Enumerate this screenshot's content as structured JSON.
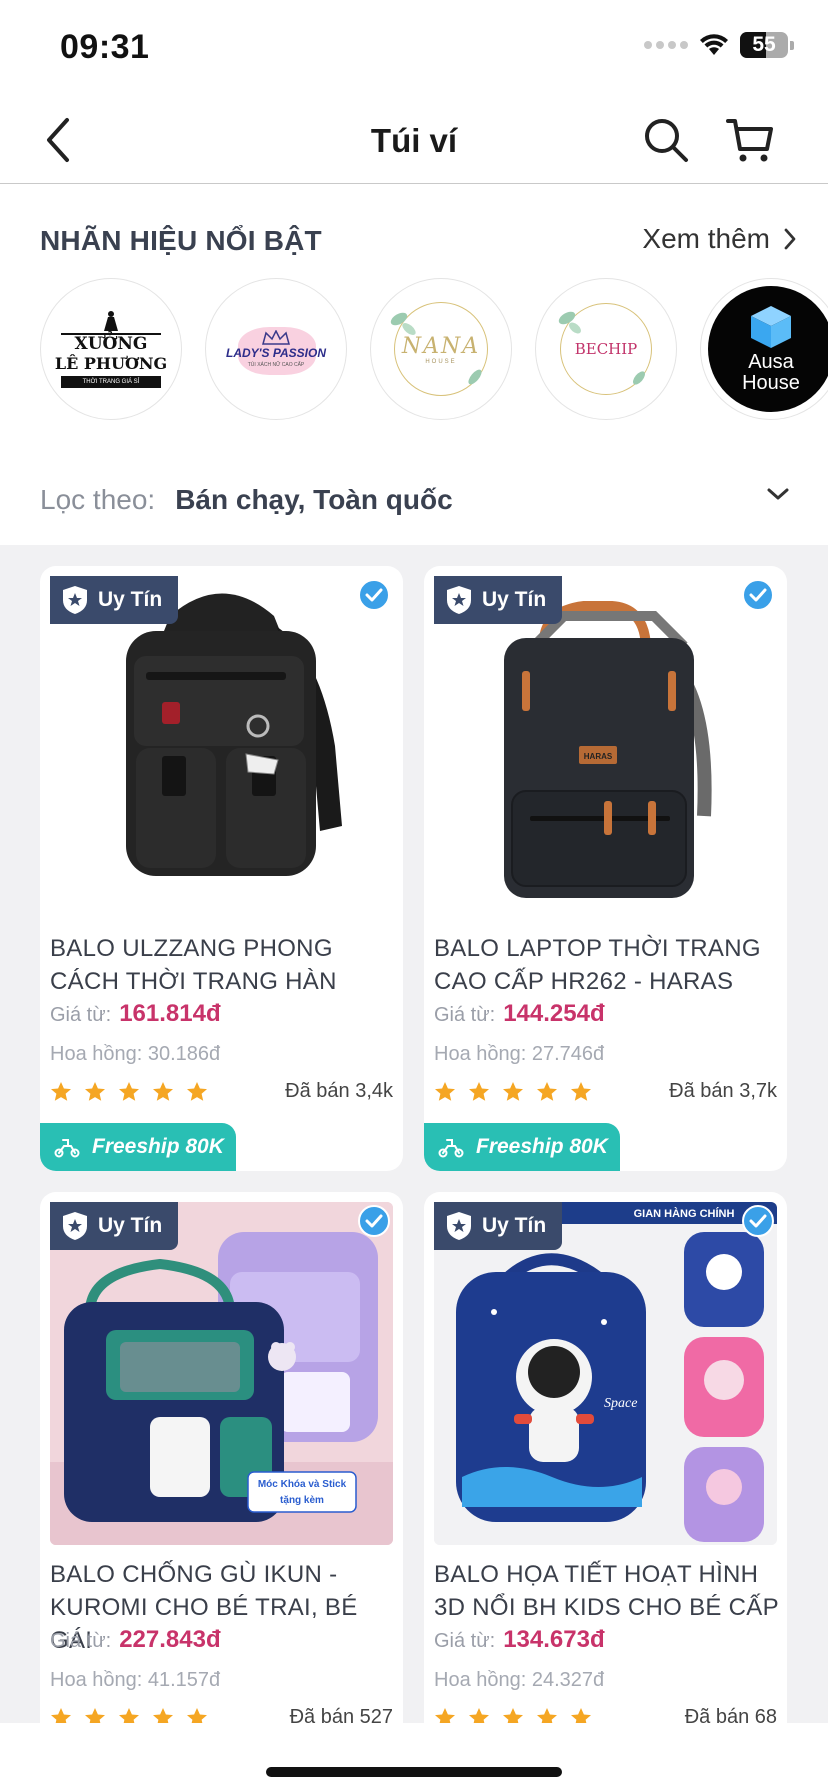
{
  "status_bar": {
    "time": "09:31",
    "battery": "55",
    "battery_level_percent": 55
  },
  "header": {
    "title": "Túi ví",
    "back_icon": "chevron-left-icon",
    "search_icon": "search-icon",
    "cart_icon": "cart-icon"
  },
  "brands": {
    "title": "NHÃN HIỆU NỔI BẬT",
    "see_more": "Xem thêm",
    "items": [
      {
        "name": "XƯỞNG LÊ PHƯƠNG",
        "line1": "XƯỞNG",
        "line2": "LÊ PHƯƠNG",
        "tagline": "THỜI TRANG GIÁ SỈ"
      },
      {
        "name": "LADY'S PASSION",
        "tagline": "TÚI XÁCH NỮ CAO CẤP"
      },
      {
        "name": "NANA",
        "sub": "HOUSE"
      },
      {
        "name": "BECHIP"
      },
      {
        "name": "Ausa House",
        "line1": "Ausa",
        "line2": "House"
      }
    ]
  },
  "filter": {
    "label": "Lọc theo:",
    "value": "Bán chạy, Toàn quốc"
  },
  "products": [
    {
      "badge": "Uy Tín",
      "name": "BALO ULZZANG PHONG CÁCH THỜI TRANG HÀN",
      "price_label": "Giá từ:",
      "price": "161.814đ",
      "commission": "Hoa hồng: 30.186đ",
      "rating": 5,
      "sold": "Đã bán 3,4k",
      "freeship": "Freeship 80K",
      "image_logo": ""
    },
    {
      "badge": "Uy Tín",
      "name": "BALO LAPTOP THỜI TRANG CAO CẤP HR262 - HARAS",
      "price_label": "Giá từ:",
      "price": "144.254đ",
      "commission": "Hoa hồng: 27.746đ",
      "rating": 5,
      "sold": "Đã bán 3,7k",
      "freeship": "Freeship 80K",
      "image_logo": "HARAS"
    },
    {
      "badge": "Uy Tín",
      "name": "BALO CHỐNG GÙ IKUN - KUROMI CHO BÉ TRAI, BÉ GÁI",
      "price_label": "Giá từ:",
      "price": "227.843đ",
      "commission": "Hoa hồng: 41.157đ",
      "rating": 5,
      "sold": "Đã bán 527",
      "image_tag": "Móc Khóa và Stick tặng kèm"
    },
    {
      "badge": "Uy Tín",
      "name": "BALO HỌA TIẾT HOẠT HÌNH 3D NỔI BH KIDS CHO BÉ CẤP",
      "price_label": "Giá từ:",
      "price": "134.673đ",
      "commission": "Hoa hồng: 24.327đ",
      "rating": 5,
      "sold": "Đã bán 68",
      "image_banner": "GIAN HÀNG CHÍNH",
      "image_text": "Space"
    }
  ],
  "colors": {
    "accent": "#c8336a",
    "badge_bg": "#3a4a6b",
    "freeship_bg": "#29bfb4",
    "star": "#f5a623",
    "verified": "#3aa0e8"
  }
}
